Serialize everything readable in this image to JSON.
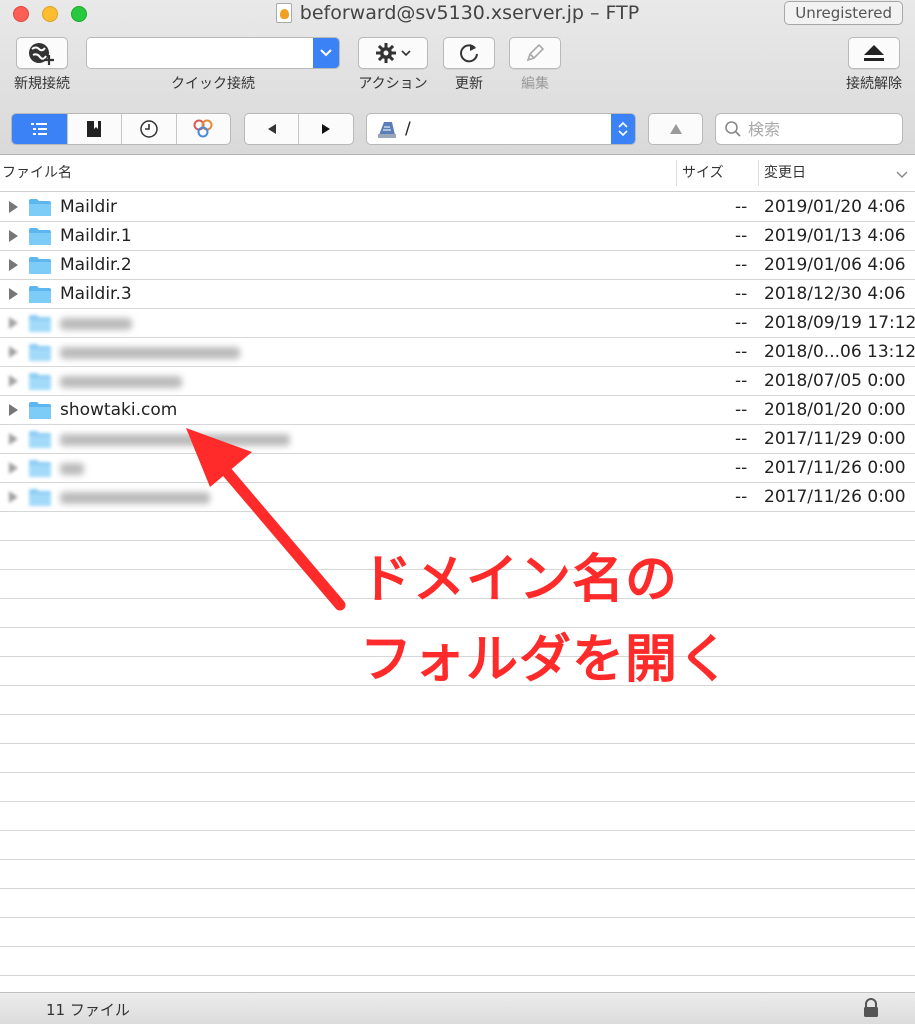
{
  "window": {
    "title": "beforward@sv5130.xserver.jp – FTP",
    "unregistered_label": "Unregistered"
  },
  "toolbar": {
    "new_connection_label": "新規接続",
    "quick_connect_label": "クイック接続",
    "quick_connect_value": "",
    "action_label": "アクション",
    "refresh_label": "更新",
    "edit_label": "編集",
    "disconnect_label": "接続解除"
  },
  "navbar": {
    "path": "/",
    "search_placeholder": "検索"
  },
  "columns": {
    "name": "ファイル名",
    "size": "サイズ",
    "modified": "変更日"
  },
  "files": [
    {
      "name": "Maildir",
      "size": "--",
      "date": "2019/01/20 4:06"
    },
    {
      "name": "Maildir.1",
      "size": "--",
      "date": "2019/01/13 4:06"
    },
    {
      "name": "Maildir.2",
      "size": "--",
      "date": "2019/01/06 4:06"
    },
    {
      "name": "Maildir.3",
      "size": "--",
      "date": "2018/12/30 4:06"
    },
    {
      "name": "",
      "size": "--",
      "date": "2018/09/19 17:12"
    },
    {
      "name": "",
      "size": "--",
      "date": "2018/0...06 13:12"
    },
    {
      "name": "",
      "size": "--",
      "date": "2018/07/05 0:00"
    },
    {
      "name": "showtaki.com",
      "size": "--",
      "date": "2018/01/20 0:00"
    },
    {
      "name": "",
      "size": "--",
      "date": "2017/11/29 0:00"
    },
    {
      "name": "",
      "size": "--",
      "date": "2017/11/26 0:00"
    },
    {
      "name": "",
      "size": "--",
      "date": "2017/11/26 0:00"
    }
  ],
  "annotation": {
    "line1": "ドメイン名の",
    "line2": "フォルダを開く",
    "color": "#ff2a2a"
  },
  "statusbar": {
    "file_count": "11 ファイル"
  },
  "colors": {
    "accent": "#3a82f6",
    "folder": "#6cc3f5"
  }
}
